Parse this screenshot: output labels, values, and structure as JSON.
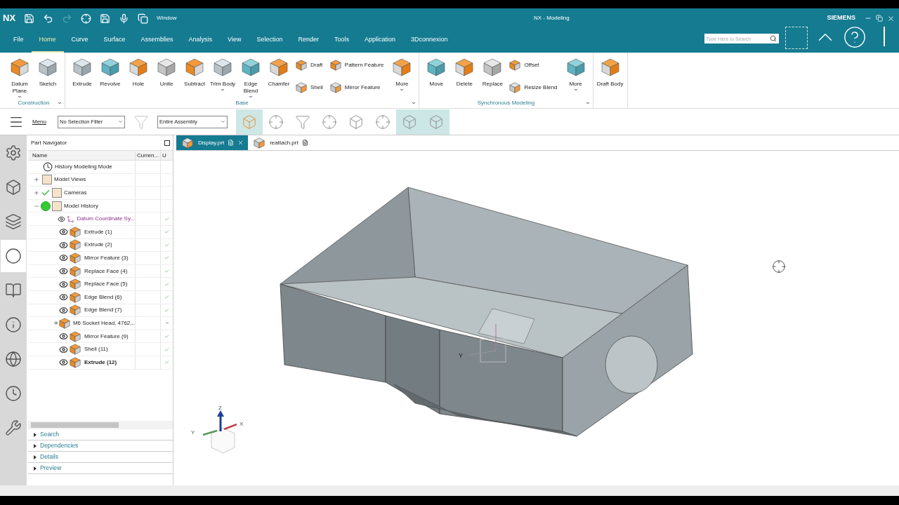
{
  "window": {
    "app": "NX",
    "title": "NX - Modeling",
    "brand": "SIEMENS",
    "window_menu": "Window"
  },
  "menu_tabs": [
    {
      "label": "File",
      "selected": false
    },
    {
      "label": "Home",
      "selected": true
    },
    {
      "label": "Curve",
      "selected": false
    },
    {
      "label": "Surface",
      "selected": false
    },
    {
      "label": "Assemblies",
      "selected": false
    },
    {
      "label": "Analysis",
      "selected": false
    },
    {
      "label": "View",
      "selected": false
    },
    {
      "label": "Selection",
      "selected": false
    },
    {
      "label": "Render",
      "selected": false
    },
    {
      "label": "Tools",
      "selected": false
    },
    {
      "label": "Application",
      "selected": false
    },
    {
      "label": "3Dconnexion",
      "selected": false
    }
  ],
  "search": {
    "placeholder": "Type Here to Search"
  },
  "ribbon": [
    {
      "title": "Construction",
      "items": [
        {
          "kind": "large",
          "label": "Datum Plane",
          "dropdown": true
        },
        {
          "kind": "large",
          "label": "Sketch",
          "dropdown": false
        }
      ]
    },
    {
      "title": "Base",
      "items": [
        {
          "kind": "large",
          "label": "Extrude",
          "dropdown": false
        },
        {
          "kind": "large",
          "label": "Revolve",
          "dropdown": false
        },
        {
          "kind": "large",
          "label": "Hole",
          "dropdown": false
        },
        {
          "kind": "large",
          "label": "Unite",
          "dropdown": false
        },
        {
          "kind": "large",
          "label": "Subtract",
          "dropdown": false
        },
        {
          "kind": "large",
          "label": "Trim Body",
          "dropdown": true
        },
        {
          "kind": "large",
          "label": "Edge Blend",
          "dropdown": true
        },
        {
          "kind": "large",
          "label": "Chamfer",
          "dropdown": false
        },
        {
          "kind": "small",
          "label": "Draft",
          "dropdown": false
        },
        {
          "kind": "small",
          "label": "Shell",
          "dropdown": false
        },
        {
          "kind": "small",
          "label": "Pattern Feature",
          "dropdown": false
        },
        {
          "kind": "small",
          "label": "Mirror Feature",
          "dropdown": false
        },
        {
          "kind": "large",
          "label": "More",
          "dropdown": true
        }
      ]
    },
    {
      "title": "Synchronous Modeling",
      "items": [
        {
          "kind": "large",
          "label": "Move",
          "dropdown": false
        },
        {
          "kind": "large",
          "label": "Delete",
          "dropdown": false
        },
        {
          "kind": "large",
          "label": "Replace",
          "dropdown": false
        },
        {
          "kind": "small",
          "label": "Offset",
          "dropdown": false
        },
        {
          "kind": "small",
          "label": "Resize Blend",
          "dropdown": false
        },
        {
          "kind": "large",
          "label": "More",
          "dropdown": true
        }
      ]
    },
    {
      "items": [
        {
          "kind": "large",
          "label": "Draft Body",
          "dropdown": false
        }
      ]
    }
  ],
  "toolbar": {
    "menu": "Menu",
    "selection_filter": "No Selection Filter",
    "scope": "Entire Assembly",
    "toggles": [
      {
        "selected": true
      },
      {
        "selected": false
      },
      {
        "selected": false
      },
      {
        "selected": false
      },
      {
        "selected": false
      },
      {
        "selected": false
      },
      {
        "selected": true
      },
      {
        "selected": true
      }
    ]
  },
  "resource_bar": [
    {
      "selected": false
    },
    {
      "selected": false
    },
    {
      "selected": false
    },
    {
      "selected": true
    },
    {
      "selected": false
    },
    {
      "selected": false
    },
    {
      "selected": false
    },
    {
      "selected": false
    },
    {
      "selected": false
    }
  ],
  "part_navigator": {
    "title": "Part Navigator",
    "columns": [
      "Name",
      "Curren...",
      "U"
    ],
    "tree": [
      {
        "label": "History Modeling Mode",
        "kind": "mode"
      },
      {
        "label": "Model Views",
        "kind": "folder",
        "expanded": false
      },
      {
        "label": "Cameras",
        "kind": "folder",
        "expanded": false,
        "checked": true
      },
      {
        "label": "Model History",
        "kind": "folder",
        "expanded": true,
        "active": true,
        "children": [
          {
            "label": "Datum Coordinate Sy...",
            "kind": "datum",
            "visible": true,
            "current": false,
            "up_to_date": true
          },
          {
            "label": "Extrude (1)",
            "kind": "feature",
            "visible": true,
            "current": false,
            "up_to_date": true
          },
          {
            "label": "Extrude (2)",
            "kind": "feature",
            "visible": true,
            "current": false,
            "up_to_date": true
          },
          {
            "label": "Mirror Feature (3)",
            "kind": "feature",
            "visible": true,
            "current": false,
            "up_to_date": true
          },
          {
            "label": "Replace Face (4)",
            "kind": "feature",
            "visible": true,
            "current": false,
            "up_to_date": true
          },
          {
            "label": "Replace Face (5)",
            "kind": "feature",
            "visible": true,
            "current": false,
            "up_to_date": true
          },
          {
            "label": "Edge Blend (6)",
            "kind": "feature",
            "visible": true,
            "current": false,
            "up_to_date": true
          },
          {
            "label": "Edge Blend (7)",
            "kind": "feature",
            "visible": true,
            "current": false,
            "up_to_date": true
          },
          {
            "label": "M6 Socket Head, 4762...",
            "kind": "feature",
            "visible": true,
            "current": false,
            "up_to_date": false
          },
          {
            "label": "Mirror Feature (9)",
            "kind": "feature",
            "visible": true,
            "current": false,
            "up_to_date": true
          },
          {
            "label": "Shell (11)",
            "kind": "feature",
            "visible": true,
            "current": false,
            "up_to_date": true
          },
          {
            "label": "Extrude (12)",
            "kind": "feature",
            "visible": true,
            "current": true,
            "up_to_date": true
          }
        ]
      }
    ],
    "panels": [
      {
        "label": "Search",
        "expanded": false
      },
      {
        "label": "Dependencies",
        "expanded": false
      },
      {
        "label": "Details",
        "expanded": false
      },
      {
        "label": "Preview",
        "expanded": false
      }
    ]
  },
  "doc_tabs": [
    {
      "label": "Display.prt",
      "selected": true
    },
    {
      "label": "reattach.prt",
      "selected": false
    }
  ],
  "viewport": {
    "datum_label": "Y",
    "triad": {
      "z": "Z",
      "x": "X",
      "y": "Y"
    }
  }
}
